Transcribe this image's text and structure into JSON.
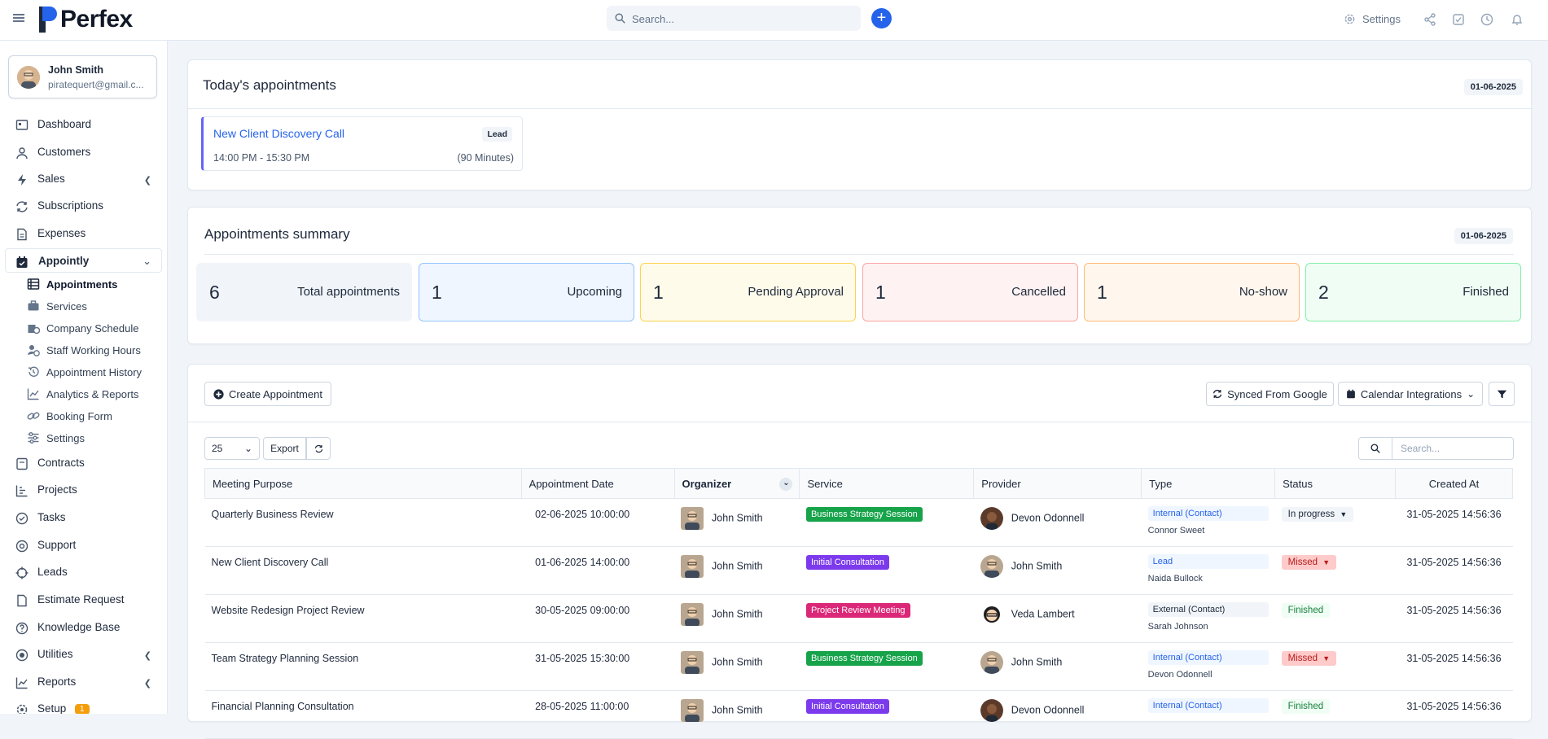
{
  "topbar": {
    "brand": "Perfex",
    "search_placeholder": "Search...",
    "settings_label": "Settings"
  },
  "user": {
    "name": "John Smith",
    "email": "piratequert@gmail.c..."
  },
  "sidebar": {
    "items": [
      {
        "label": "Dashboard"
      },
      {
        "label": "Customers"
      },
      {
        "label": "Sales"
      },
      {
        "label": "Subscriptions"
      },
      {
        "label": "Expenses"
      },
      {
        "label": "Appointly"
      },
      {
        "label": "Contracts"
      },
      {
        "label": "Projects"
      },
      {
        "label": "Tasks"
      },
      {
        "label": "Support"
      },
      {
        "label": "Leads"
      },
      {
        "label": "Estimate Request"
      },
      {
        "label": "Knowledge Base"
      },
      {
        "label": "Utilities"
      },
      {
        "label": "Reports"
      },
      {
        "label": "Setup"
      }
    ],
    "appointly_sub": [
      {
        "label": "Appointments"
      },
      {
        "label": "Services"
      },
      {
        "label": "Company Schedule"
      },
      {
        "label": "Staff Working Hours"
      },
      {
        "label": "Appointment History"
      },
      {
        "label": "Analytics & Reports"
      },
      {
        "label": "Booking Form"
      },
      {
        "label": "Settings"
      }
    ],
    "setup_badge": "1"
  },
  "today": {
    "title": "Today's appointments",
    "date": "01-06-2025",
    "appointment": {
      "title": "New Client Discovery Call",
      "badge": "Lead",
      "time": "14:00 PM - 15:30 PM",
      "duration": "(90 Minutes)"
    }
  },
  "summary": {
    "title": "Appointments summary",
    "date": "01-06-2025",
    "stats": [
      {
        "count": "6",
        "label": "Total appointments",
        "bg": "#f1f5f9",
        "border": "#f1f5f9"
      },
      {
        "count": "1",
        "label": "Upcoming",
        "bg": "#eff6ff",
        "border": "#93c5fd"
      },
      {
        "count": "1",
        "label": "Pending Approval",
        "bg": "#fffbeb",
        "border": "#fcd34d"
      },
      {
        "count": "1",
        "label": "Cancelled",
        "bg": "#fef2f2",
        "border": "#fca5a5"
      },
      {
        "count": "1",
        "label": "No-show",
        "bg": "#fff7ed",
        "border": "#fdba74"
      },
      {
        "count": "2",
        "label": "Finished",
        "bg": "#f0fdf4",
        "border": "#86efac"
      }
    ]
  },
  "toolbar": {
    "create_label": "Create Appointment",
    "synced_label": "Synced From Google",
    "calendar_label": "Calendar Integrations",
    "page_size": "25",
    "export_label": "Export",
    "search_placeholder": "Search..."
  },
  "table": {
    "headers": [
      "Meeting Purpose",
      "Appointment Date",
      "Organizer",
      "Service",
      "Provider",
      "Type",
      "Status",
      "Created At"
    ],
    "rows": [
      {
        "purpose": "Quarterly Business Review",
        "date": "02-06-2025 10:00:00",
        "organizer": "John Smith",
        "service": "Business Strategy Session",
        "service_color": "#16a34a",
        "provider": "Devon Odonnell",
        "type": "Internal (Contact)",
        "type_color": "#2563eb",
        "type_bg": "#eff6ff",
        "type_sub": "Connor Sweet",
        "status": "In progress",
        "status_color": "#1e293b",
        "status_bg": "#f1f5f9",
        "status_dd": true,
        "created": "31-05-2025 14:56:36"
      },
      {
        "purpose": "New Client Discovery Call",
        "date": "01-06-2025 14:00:00",
        "organizer": "John Smith",
        "service": "Initial Consultation",
        "service_color": "#7c3aed",
        "provider": "John Smith",
        "type": "Lead",
        "type_color": "#2563eb",
        "type_bg": "#eff6ff",
        "type_sub": "Naida Bullock",
        "status": "Missed",
        "status_color": "#b91c1c",
        "status_bg": "#fecaca",
        "status_dd": true,
        "created": "31-05-2025 14:56:36"
      },
      {
        "purpose": "Website Redesign Project Review",
        "date": "30-05-2025 09:00:00",
        "organizer": "John Smith",
        "service": "Project Review Meeting",
        "service_color": "#db2777",
        "provider": "Veda Lambert",
        "type": "External (Contact)",
        "type_color": "#1e293b",
        "type_bg": "#f1f5f9",
        "type_sub": "Sarah Johnson",
        "status": "Finished",
        "status_color": "#15803d",
        "status_bg": "#f0fdf4",
        "status_dd": false,
        "created": "31-05-2025 14:56:36"
      },
      {
        "purpose": "Team Strategy Planning Session",
        "date": "31-05-2025 15:30:00",
        "organizer": "John Smith",
        "service": "Business Strategy Session",
        "service_color": "#16a34a",
        "provider": "John Smith",
        "type": "Internal (Contact)",
        "type_color": "#2563eb",
        "type_bg": "#eff6ff",
        "type_sub": "Devon Odonnell",
        "status": "Missed",
        "status_color": "#b91c1c",
        "status_bg": "#fecaca",
        "status_dd": true,
        "created": "31-05-2025 14:56:36"
      },
      {
        "purpose": "Financial Planning Consultation",
        "date": "28-05-2025 11:00:00",
        "organizer": "John Smith",
        "service": "Initial Consultation",
        "service_color": "#7c3aed",
        "provider": "Devon Odonnell",
        "type": "Internal (Contact)",
        "type_color": "#2563eb",
        "type_bg": "#eff6ff",
        "type_sub": "",
        "status": "Finished",
        "status_color": "#15803d",
        "status_bg": "#f0fdf4",
        "status_dd": false,
        "created": "31-05-2025 14:56:36"
      }
    ]
  }
}
